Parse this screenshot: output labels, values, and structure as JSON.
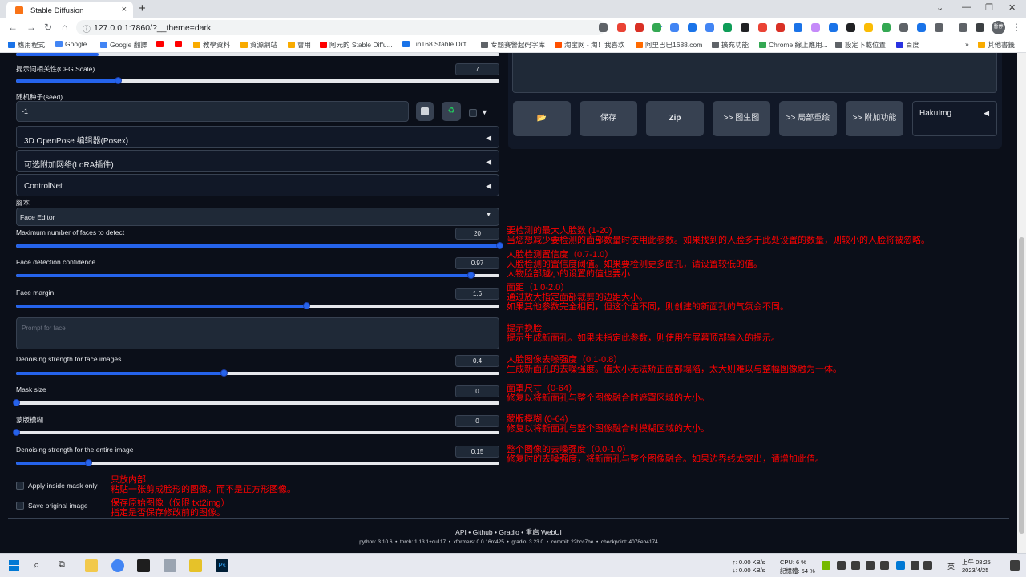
{
  "browser": {
    "tab_title": "Stable Diffusion",
    "tab_close": "×",
    "new_tab": "+",
    "url": "127.0.0.1:7860/?__theme=dark",
    "bookmarks": [
      "應用程式",
      "Google",
      "Google 翻譯",
      "",
      "教學資料",
      "資源網站",
      "會用",
      "阿元的 Stable Diffu...",
      "Tin168 Stable Diff...",
      "专题赛警起码字库",
      "淘宝网 - 淘！我喜欢",
      "阿里巴巴1688.com",
      "擴充功能",
      "Chrome 線上應用...",
      "設定下載位置",
      "百度"
    ],
    "bookmarks_more": "»",
    "other_bookmarks": "其他書籤",
    "profile": "暫停",
    "colors": {
      "accent": "#1a73e8"
    }
  },
  "settings": {
    "cfg_label": "提示词相关性(CFG Scale)",
    "cfg_value": "7",
    "cfg_fraction": 0.21,
    "seed_label": "随机种子(seed)",
    "seed_value": "-1"
  },
  "accordions": [
    {
      "title": "3D OpenPose 编辑器(Posex)"
    },
    {
      "title": "可选附加网络(LoRA插件)"
    },
    {
      "title": "ControlNet"
    }
  ],
  "script": {
    "label": "腳本",
    "selected": "Face Editor"
  },
  "face_editor": {
    "max_faces": {
      "label": "Maximum number of faces to detect",
      "value": "20",
      "fraction": 1.0
    },
    "confidence": {
      "label": "Face detection confidence",
      "value": "0.97",
      "fraction": 0.94
    },
    "margin": {
      "label": "Face margin",
      "value": "1.6",
      "fraction": 0.6
    },
    "prompt_placeholder": "Prompt for face",
    "denoise_face": {
      "label": "Denoising strength for face images",
      "value": "0.4",
      "fraction": 0.43
    },
    "mask_size": {
      "label": "Mask size",
      "value": "0",
      "fraction": 0.0
    },
    "mask_blur": {
      "label": "蒙版模糊",
      "value": "0",
      "fraction": 0.0
    },
    "denoise_entire": {
      "label": "Denoising strength for the entire image",
      "value": "0.15",
      "fraction": 0.15
    },
    "apply_inside_mask": "Apply inside mask only",
    "save_original": "Save original image"
  },
  "output_buttons": {
    "folder": "📂",
    "save": "保存",
    "zip": "Zip",
    "to_img2img": ">> 图生图",
    "to_inpaint": ">> 局部重绘",
    "to_extras": ">> 附加功能",
    "hakuimg": "HakuImg"
  },
  "notes": {
    "n1": [
      "要检测的最大人脸数 (1-20)",
      "当您想减少要检测的面部数量时使用此参数。如果找到的人脸多于此处设置的数量，则较小的人脸将被忽略。"
    ],
    "n2": [
      "人脸检测置信度（0.7-1.0）",
      "人脸检测的置信度阈值。如果要检测更多面孔，请设置较低的值。",
      "人物脸部越小的设置的值也要小"
    ],
    "n3": [
      "面距（1.0-2.0）",
      "通过放大指定面部裁剪的边距大小。",
      "如果其他参数完全相同，但这个值不同，则创建的新面孔的气氛会不同。"
    ],
    "n4": [
      "提示换脸",
      "提示生成新面孔。如果未指定此参数，则使用在屏幕顶部输入的提示。"
    ],
    "n5": [
      "人脸图像去噪强度（0.1-0.8）",
      "生成新面孔的去噪强度。值太小无法矫正面部塌陷，太大则难以与整幅图像融为一体。"
    ],
    "n6": [
      "面罩尺寸（0-64）",
      "修复以将新面孔与整个图像融合时遮罩区域的大小。"
    ],
    "n7": [
      "蒙版模糊 (0-64)",
      "修复以将新面孔与整个图像融合时模糊区域的大小。"
    ],
    "n8": [
      "整个图像的去噪强度（0.0-1.0）",
      "修复时的去噪强度，将新面孔与整个图像融合。如果边界线太突出，请增加此值。"
    ],
    "n9": [
      "只放内部",
      "粘贴一张剪成脸形的图像，而不是正方形图像。"
    ],
    "n10": [
      "保存原始图像（仅限 txt2img）",
      "指定是否保存修改前的图像。"
    ]
  },
  "footer": {
    "links": [
      "API",
      "Github",
      "Gradio",
      "重启 WebUI"
    ],
    "sep": "•",
    "versions": "python: 3.10.6  •  torch: 1.13.1+cu117  •  xformers: 0.0.16rc425  •  gradio: 3.23.0  •  commit: 22bcc7be  •  checkpoint: 4078eb4174"
  },
  "taskbar": {
    "net_up": "↑: 0.00 KB/s",
    "net_down": "↓: 0.00 KB/s",
    "cpu": "CPU: 6 %",
    "mem": "記憶體: 54 %",
    "lang": "英",
    "time": "上午 08:25",
    "date": "2023/4/25"
  }
}
